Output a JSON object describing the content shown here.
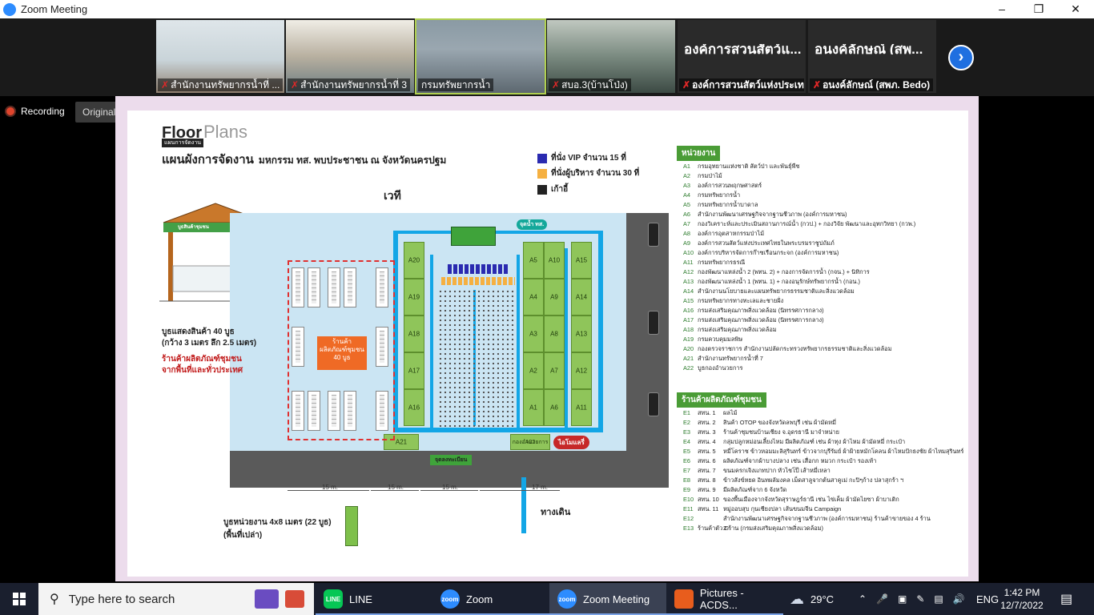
{
  "window": {
    "title": "Zoom Meeting",
    "controls": {
      "minimize": "–",
      "maximize": "❐",
      "close": "✕"
    }
  },
  "participants": [
    {
      "name": "สำนักงานทรัพยากรน้ำที่ ...",
      "muted": true,
      "video": true,
      "tint": "#c9d4d9"
    },
    {
      "name": "สำนักงานทรัพยากรน้ำที่ 3",
      "muted": true,
      "video": true,
      "tint": "#b8b0a0"
    },
    {
      "name": "กรมทรัพยากรน้ำ",
      "muted": false,
      "video": true,
      "tint": "#9aa7b0",
      "active": true
    },
    {
      "name": "สบอ.3(บ้านโป่ง)",
      "muted": true,
      "video": true,
      "tint": "#7a8a80"
    },
    {
      "name": "องค์การสวนสัตว์แห่งประเท...",
      "muted": true,
      "video": false,
      "big": "องค์การสวนสัตว์แ..."
    },
    {
      "name": "อนงค์ลักษณ์ (สพภ. Bedo)",
      "muted": true,
      "video": false,
      "big": "อนงค์ลักษณ์ (สพ..."
    }
  ],
  "next_icon": "chevron-right",
  "recording_label": "Recording",
  "original_sound": "Original Sound for Musicians: Off",
  "slide": {
    "floor": "Floor",
    "plans": "Plans",
    "floor_sub": "แผนการจัดงาน",
    "title": "แผนผังการจัดงาน",
    "title_sub": "มหกรรม ทส. พบประชาชน ณ จังหวัดนครปฐม",
    "legend": [
      {
        "label": "ที่นั่ง VIP จำนวน 15 ที่",
        "color": "#2a2ab0"
      },
      {
        "label": "ที่นั่งผู้บริหาร จำนวน 30 ที่",
        "color": "#f5b041"
      },
      {
        "label": "เก้าอี้",
        "color": "#222222"
      }
    ],
    "stage_label": "เวที",
    "water_label": "จุดน้ำ ทส.",
    "left_booths": [
      "A20",
      "A19",
      "A18",
      "A17",
      "A16"
    ],
    "mid_booths": [
      [
        "A5",
        "A10"
      ],
      [
        "A4",
        "A9"
      ],
      [
        "A3",
        "A8"
      ],
      [
        "A2",
        "A7"
      ],
      [
        "A1",
        "A6"
      ]
    ],
    "right_booths": [
      "A15",
      "A14",
      "A13",
      "A12",
      "A11"
    ],
    "a21": "A21",
    "a22": "A22",
    "a22_sub": "กองอำนวยการ",
    "tent_label": "บูธสินค้าชุมชน",
    "shop_box": "ร้านค้า\nผลิตภัณฑ์ชุมชน\n40 บูธ",
    "booth_note1": "บูธแสดงสินค้า 40 บูธ",
    "booth_note2": "(กว้าง 3 เมตร ลึก 2.5 เมตร)",
    "booth_note3": "ร้านค้าผลิตภัณฑ์ชุมชน",
    "booth_note4": "จากพื้นที่และทั่วประเทศ",
    "agency_booth1": "บูธหน่วยงาน 4x8 เมตร (22 บูธ)",
    "agency_booth2": "(พื้นที่เปล่า)",
    "walkway": "ทางเดิน",
    "entrance": "จุดลงทะเบียน",
    "toilet": "ไอโมแลรี่",
    "dims": [
      "15 m.",
      "15 m.",
      "15 m.",
      "17 m."
    ],
    "units_head": "หน่วยงาน",
    "units": [
      [
        "A1",
        "กรมอุทยานแห่งชาติ สัตว์ป่า และพันธุ์พืช"
      ],
      [
        "A2",
        "กรมป่าไม้"
      ],
      [
        "A3",
        "องค์การสวนพฤกษศาสตร์"
      ],
      [
        "A4",
        "กรมทรัพยากรน้ำ"
      ],
      [
        "A5",
        "กรมทรัพยากรน้ำบาดาล"
      ],
      [
        "A6",
        "สำนักงานพัฒนาเศรษฐกิจจากฐานชีวภาพ (องค์การมหาชน)"
      ],
      [
        "A7",
        "กองวิเคราะห์และประเมินสถานการณ์น้ำ (กวป.) + กองวิจัย พัฒนาและอุทกวิทยา (กวพ.)"
      ],
      [
        "A8",
        "องค์การอุตสาหกรรมป่าไม้"
      ],
      [
        "A9",
        "องค์การสวนสัตว์แห่งประเทศไทยในพระบรมราชูปถัมภ์"
      ],
      [
        "A10",
        "องค์การบริหารจัดการก๊าซเรือนกระจก (องค์การมหาชน)"
      ],
      [
        "A11",
        "กรมทรัพยากรธรณี"
      ],
      [
        "A12",
        "กองพัฒนาแหล่งน้ำ 2 (พทน. 2) + กองการจัดการน้ำ (กจน.) + นิทิการ"
      ],
      [
        "A13",
        "กองพัฒนาแหล่งน้ำ 1 (พทน. 1) + กองอนุรักษ์ทรัพยากรน้ำ (กอน.)"
      ],
      [
        "A14",
        "สำนักงานนโยบายและแผนทรัพยากรธรรมชาติและสิ่งแวดล้อม"
      ],
      [
        "A15",
        "กรมทรัพยากรทางทะเลและชายฝั่ง"
      ],
      [
        "A16",
        "กรมส่งเสริมคุณภาพสิ่งแวดล้อม (นิทรรศการกลาง)"
      ],
      [
        "A17",
        "กรมส่งเสริมคุณภาพสิ่งแวดล้อม (นิทรรศการกลาง)"
      ],
      [
        "A18",
        "กรมส่งเสริมคุณภาพสิ่งแวดล้อม"
      ],
      [
        "A19",
        "กรมควบคุมมลพิษ"
      ],
      [
        "A20",
        "กองตรวจราชการ สำนักงานปลัดกระทรวงทรัพยากรธรรมชาติและสิ่งแวดล้อม"
      ],
      [
        "A21",
        "สำนักงานทรัพยากรน้ำที่ 7"
      ],
      [
        "A22",
        "บูธกองอำนวยการ"
      ]
    ],
    "shops_head": "ร้านค้าผลิตภัณฑ์ชุมชน",
    "shops": [
      [
        "E1",
        "สทน. 1",
        "ผลไม้"
      ],
      [
        "E2",
        "สทน. 2",
        "สินค้า OTOP ของจังหวัดลพบุรี เช่น ผ้ามัดหมี่"
      ],
      [
        "E3",
        "สทน. 3",
        "ร้านค้าชุมชนบ้านเชียง จ.อุดรธานี มาจำหน่าย"
      ],
      [
        "E4",
        "สทน. 4",
        "กลุ่มปลูกหม่อนเลี้ยงไหม มีผลิตภัณฑ์ เช่น ผ้าทุง ผ้าไหม ผ้ามัดหมี่ กระเป๋า"
      ],
      [
        "E5",
        "สทน. 5",
        "หมี่โคราช ข้าวหอมมะลิสุรินทร์ ข้าวจากบุรีรัมย์ ผ้าฝ้ายหมักโคลน ผ้าไหมปักธงชัย ผ้าไหมสุรินทร์"
      ],
      [
        "E6",
        "สทน. 6",
        "ผลิตภัณฑ์จากผ้าบางปลาง เช่น เสื่อกก หมวก กระเป๋า รองเท้า"
      ],
      [
        "E7",
        "สทน. 7",
        "ขนมครกเจิงแกทปาก หัวไชโป๊ เส้าหมี่เหลา"
      ],
      [
        "E8",
        "สทน. 8",
        "ข้าวสังข์หยด อินทผลัมงคล เม็ดสาลูจากต้นสาคูเม่ กะปิๆก้าง ปลาสุกร้า ฯ"
      ],
      [
        "E9",
        "สทน. 9",
        "มีผลิตภัณฑ์จาก 6 จังหวัด"
      ],
      [
        "E10",
        "สทน. 10",
        "ของพื้นเมืองจากจังหวัดสุราษฎร์ธานี เช่น ไข่เค็ม ผ้ามัดไยซา ผ้าบาเติก"
      ],
      [
        "E11",
        "สทน. 11",
        "หมู่ออบสุบ กุนเชียงปลา เส้นขนมจีน Campaign"
      ],
      [
        "E12",
        "",
        "สำนักงานพัฒนาเศรษฐกิจจากฐานชีวภาพ (องค์การมหาชน) ร้านค้าขายของ 4 ร้าน"
      ],
      [
        "E13",
        "ร้านค้าตัว G",
        "2 ร้าน (กรมส่งเสริมคุณภาพสิ่งแวดล้อม)"
      ]
    ]
  },
  "taskbar": {
    "search_placeholder": "Type here to search",
    "apps": [
      {
        "label": "LINE",
        "icon": "line-icon",
        "color": "#06c755",
        "active": false
      },
      {
        "label": "Zoom",
        "icon": "zoom-icon",
        "color": "#2d8cff",
        "active": false
      },
      {
        "label": "Zoom Meeting",
        "icon": "zoom-icon",
        "color": "#2d8cff",
        "active": true
      },
      {
        "label": "Pictures - ACDS...",
        "icon": "acdsee-icon",
        "color": "#e85d1d",
        "active": false
      }
    ],
    "weather": "29°C",
    "language": "ENG",
    "time": "1:42 PM",
    "date": "12/7/2022"
  }
}
